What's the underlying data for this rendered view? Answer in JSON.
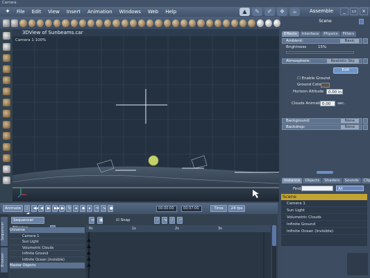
{
  "app": {
    "title": "Carrara",
    "room": "Assemble"
  },
  "menu": [
    "File",
    "Edit",
    "View",
    "Insert",
    "Animation",
    "Windows",
    "Web",
    "Help"
  ],
  "viewport": {
    "title": "3DView of Sunbeams.car",
    "camera_label": "Camera 1 100%"
  },
  "right_panel": {
    "scene_label": "Scene",
    "tabs": [
      "Effects",
      "Interface",
      "Physics",
      "Filters"
    ],
    "ambient": {
      "label": "Ambient:",
      "value": "Basic"
    },
    "brightness": {
      "label": "Brightness",
      "value": "15%"
    },
    "atmosphere": {
      "label": "Atmosphere:",
      "value": "Realistic Sky"
    },
    "edit_label": "Edit",
    "enable_ground_label": "Enable Ground",
    "ground_color_label": "Ground Color",
    "horizon_altitude": {
      "label": "Horizon Altitude",
      "value": "0.00 in"
    },
    "clouds_animation": {
      "label": "Clouds Animation",
      "value": "0.00",
      "unit": "sec."
    },
    "background": {
      "label": "Background:",
      "value": "None"
    },
    "backdrop": {
      "label": "Backdrop:",
      "value": "None"
    },
    "instance_tabs": [
      "Instance",
      "Objects",
      "Shaders",
      "Sounds",
      "Clips"
    ],
    "find_label": "Find:",
    "find_value": "",
    "find_filter": "All",
    "scene_header": "Scene",
    "scene_items": [
      "Camera 1",
      "Sun Light",
      "Volumetric Clouds",
      "Infinite Ground",
      "Infinite Ocean (invisible)"
    ]
  },
  "transport": {
    "animate_label": "Animate",
    "time_current": "00:00:00",
    "time_end": "00:07:00",
    "time_mode": "Time",
    "fps": "24 fps"
  },
  "sequencer": {
    "side_tabs": [
      "Sequencer",
      "Browser"
    ],
    "mode": "Sequencer",
    "filter_label": "Filtering",
    "snap_label": "Snap",
    "tree": [
      "Universe",
      "Camera 1",
      "Sun Light",
      "Volumetric Clouds",
      "Infinite Ground",
      "Infinite Ocean (invisible)",
      "Master Objects"
    ],
    "ruler": [
      "0s",
      "1s",
      "2s",
      "3s"
    ]
  }
}
